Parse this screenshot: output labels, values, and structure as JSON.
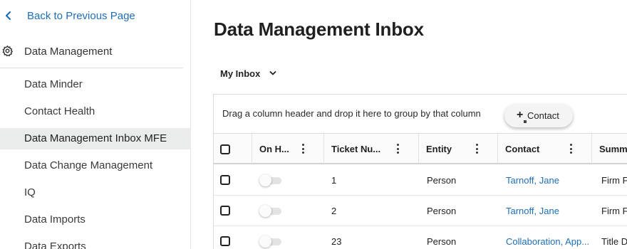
{
  "sidebar": {
    "back_label": "Back to Previous Page",
    "section_label": "Data Management",
    "items": [
      {
        "label": "Data Minder"
      },
      {
        "label": "Contact Health"
      },
      {
        "label": "Data Management Inbox MFE"
      },
      {
        "label": "Data Change Management"
      },
      {
        "label": "IQ"
      },
      {
        "label": "Data Imports"
      },
      {
        "label": "Data Exports"
      }
    ],
    "active_item": "Data Management Inbox MFE"
  },
  "main": {
    "title": "Data Management Inbox",
    "inbox_select": {
      "value": "My Inbox"
    },
    "group_panel_text": "Drag a column header and drop it here to group by that column",
    "drag_chip": {
      "label": "Contact",
      "icon": "plus-icon"
    },
    "columns": [
      {
        "label": "On H..."
      },
      {
        "label": "Ticket Nu..."
      },
      {
        "label": "Entity"
      },
      {
        "label": "Contact"
      },
      {
        "label": "Summ"
      }
    ],
    "rows": [
      {
        "on_hold": false,
        "ticket": "1",
        "entity": "Person",
        "contact": "Tarnoff, Jane",
        "summary": "Firm F"
      },
      {
        "on_hold": false,
        "ticket": "2",
        "entity": "Person",
        "contact": "Tarnoff, Jane",
        "summary": "Firm F"
      },
      {
        "on_hold": false,
        "ticket": "23",
        "entity": "Person",
        "contact": "Collaboration, App...",
        "summary": "Title D"
      }
    ]
  },
  "colors": {
    "link": "#1e6fb8",
    "active_nav_bg": "#eaebeb",
    "text": "#212121"
  }
}
